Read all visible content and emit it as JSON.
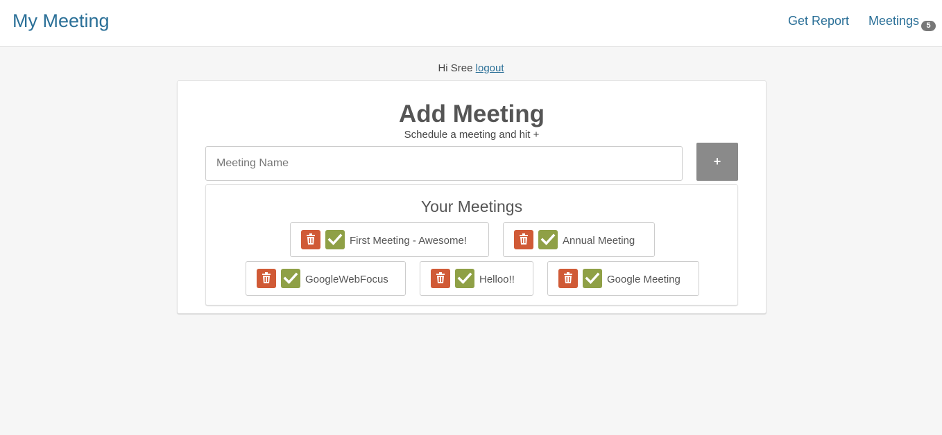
{
  "navbar": {
    "brand": "My Meeting",
    "report_label": "Get Report",
    "meetings_label": "Meetings",
    "meetings_count": "5"
  },
  "greeting": {
    "text": "Hi Sree",
    "logout_label": "logout"
  },
  "add_meeting": {
    "title": "Add Meeting",
    "subtitle": "Schedule a meeting and hit +",
    "input_placeholder": "Meeting Name",
    "input_value": "",
    "add_label": "+"
  },
  "meetings_list": {
    "title": "Your Meetings",
    "items": [
      {
        "name": "First Meeting - Awesome!",
        "delete_icon": "trash-icon",
        "done_icon": "check-icon"
      },
      {
        "name": "Annual Meeting",
        "delete_icon": "trash-icon",
        "done_icon": "check-icon"
      },
      {
        "name": "GoogleWebFocus",
        "delete_icon": "trash-icon",
        "done_icon": "check-icon"
      },
      {
        "name": "Helloo!!",
        "delete_icon": "trash-icon",
        "done_icon": "check-icon"
      },
      {
        "name": "Google Meeting",
        "delete_icon": "trash-icon",
        "done_icon": "check-icon"
      }
    ]
  },
  "colors": {
    "brand": "#2a6f97",
    "delete": "#d05a36",
    "done": "#8fa046",
    "add_button": "#8a8a8a"
  }
}
